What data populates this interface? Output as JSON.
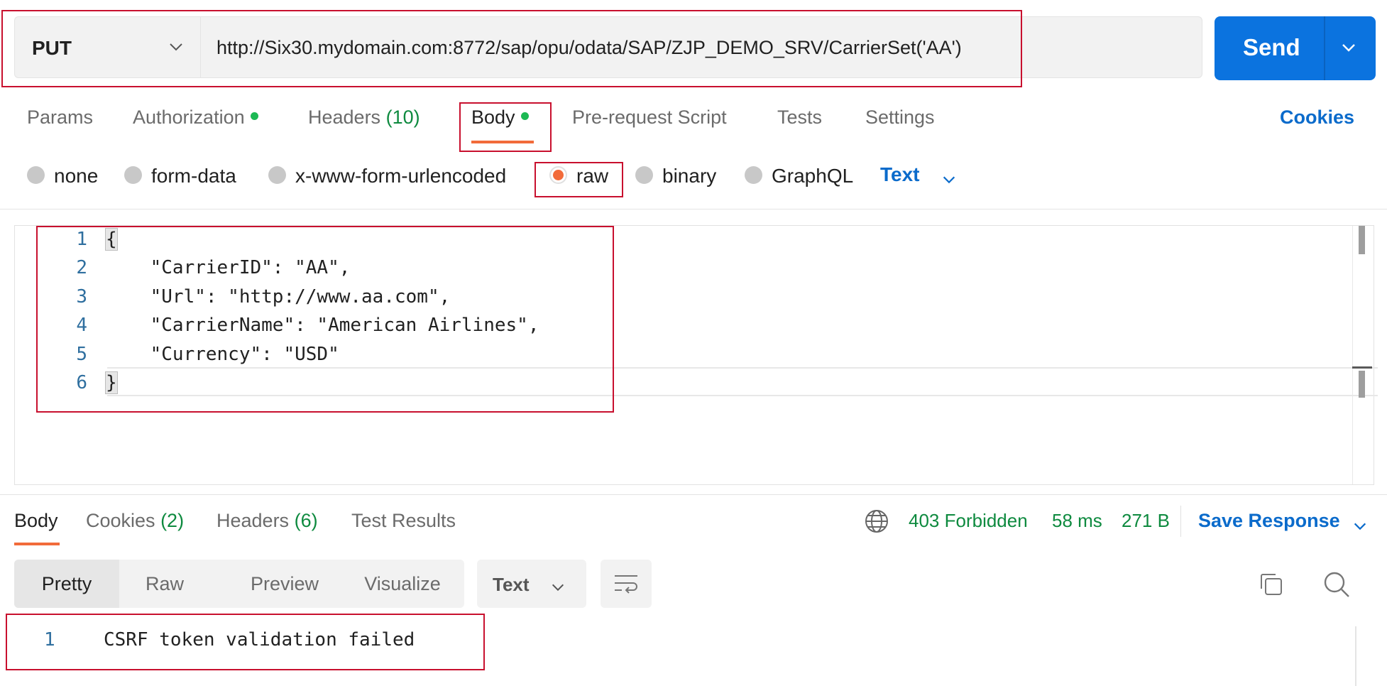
{
  "request": {
    "method": "PUT",
    "url": "http://Six30.mydomain.com:8772/sap/opu/odata/SAP/ZJP_DEMO_SRV/CarrierSet('AA')",
    "send_label": "Send"
  },
  "request_tabs": {
    "params": "Params",
    "authorization": "Authorization",
    "headers": "Headers",
    "headers_count": "(10)",
    "body": "Body",
    "pre_request": "Pre-request Script",
    "tests": "Tests",
    "settings": "Settings",
    "cookies": "Cookies"
  },
  "body_types": {
    "none": "none",
    "form_data": "form-data",
    "urlencoded": "x-www-form-urlencoded",
    "raw": "raw",
    "binary": "binary",
    "graphql": "GraphQL",
    "selected": "raw",
    "format": "Text"
  },
  "editor": {
    "lines": [
      {
        "n": "1",
        "text": "{"
      },
      {
        "n": "2",
        "text": "    \"CarrierID\": \"AA\","
      },
      {
        "n": "3",
        "text": "    \"Url\": \"http://www.aa.com\","
      },
      {
        "n": "4",
        "text": "    \"CarrierName\": \"American Airlines\","
      },
      {
        "n": "5",
        "text": "    \"Currency\": \"USD\""
      },
      {
        "n": "6",
        "text": "}"
      }
    ]
  },
  "response_tabs": {
    "body": "Body",
    "cookies": "Cookies",
    "cookies_count": "(2)",
    "headers": "Headers",
    "headers_count": "(6)",
    "test_results": "Test Results"
  },
  "response_status": {
    "status": "403 Forbidden",
    "time": "58 ms",
    "size": "271 B",
    "save_response": "Save Response"
  },
  "response_view": {
    "pretty": "Pretty",
    "raw": "Raw",
    "preview": "Preview",
    "visualize": "Visualize",
    "format": "Text"
  },
  "response_body": {
    "line_number": "1",
    "text": "CSRF token validation failed"
  },
  "colors": {
    "accent": "#f26b3a",
    "send": "#0b73df",
    "link": "#0b6bcb",
    "success": "#0e8a3f",
    "annotation": "#c8102e"
  }
}
